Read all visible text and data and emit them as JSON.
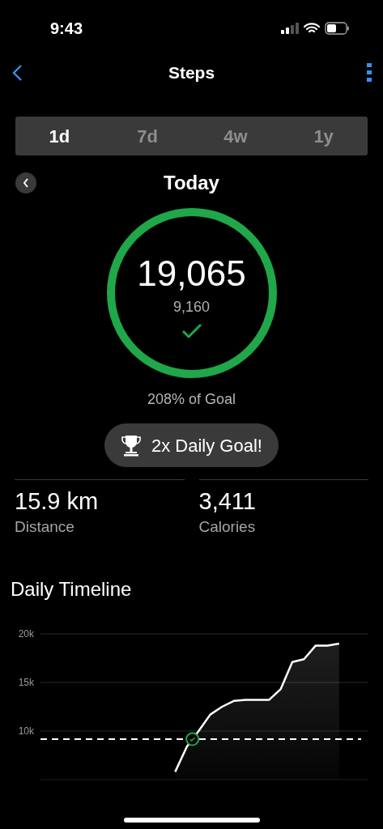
{
  "status_bar": {
    "time": "9:43"
  },
  "nav": {
    "title": "Steps"
  },
  "tabs": [
    {
      "label": "1d",
      "selected": true
    },
    {
      "label": "7d",
      "selected": false
    },
    {
      "label": "4w",
      "selected": false
    },
    {
      "label": "1y",
      "selected": false
    }
  ],
  "period": {
    "title": "Today"
  },
  "ring": {
    "steps": "19,065",
    "goal": "9,160",
    "goal_met": true,
    "level": 1
  },
  "goal_percent": "208% of Goal",
  "achievement": "2x Daily Goal!",
  "stats": [
    {
      "value": "15.9 km",
      "label": "Distance"
    },
    {
      "value": "3,411",
      "label": "Calories"
    }
  ],
  "timeline": {
    "title": "Daily Timeline",
    "chart_data": {
      "type": "area",
      "ylim": [
        5,
        20
      ],
      "yticks": [
        {
          "value": 10,
          "label": "10k"
        },
        {
          "value": 15,
          "label": "15k"
        },
        {
          "value": 20,
          "label": "20k"
        }
      ],
      "categories": [
        null,
        null,
        null,
        null,
        null,
        null,
        null,
        null,
        null,
        null,
        null,
        null,
        null,
        null,
        null,
        null,
        null,
        null,
        null,
        null,
        null,
        null,
        null,
        null,
        null,
        null,
        null,
        null
      ],
      "series": [
        {
          "color": "#ffffff",
          "values": [
            null,
            null,
            null,
            null,
            null,
            null,
            null,
            null,
            null,
            null,
            null,
            5.8,
            8.4,
            10.0,
            11.7,
            12.5,
            13.1,
            13.2,
            13.2,
            13.2,
            14.3,
            17.1,
            17.4,
            18.8,
            18.8,
            19.0,
            null,
            null
          ]
        }
      ],
      "ref_lines": [
        {
          "axis": "y",
          "value": 9.16
        }
      ]
    }
  }
}
